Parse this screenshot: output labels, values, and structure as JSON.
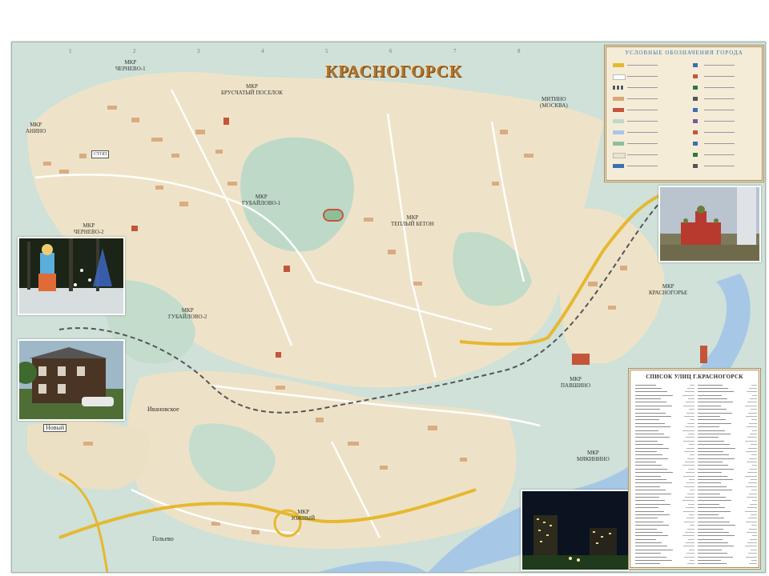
{
  "map": {
    "title": "КРАСНОГОРСК",
    "labels": {
      "cherevo1": "МКР\nЧЕРНЕВО-1",
      "brusyany": "МКР\nБРУСЧАТЫЙ ПОСЕЛОК",
      "anino": "МКР\nАНИНО",
      "cherevo2": "МКР\nЧЕРНЕВО-2",
      "gubailovo1": "МКР\nГУБАЙЛОВО-1",
      "gubailovo2": "МКР\nГУБАЙЛОВО-2",
      "teply_beton": "МКР\nТЕПЛЫЙ БЕТОН",
      "mitino": "МИТИНО\n(МОСКВА)",
      "krasnogorye": "МКР\nКРАСНОГОРЬЕ",
      "pavshino": "МКР\nПАВШИНО",
      "opaliha": "МКР\nМЯКИНИНО",
      "yuzhny": "МКР\nЮЖНЫЙ",
      "ivanovskoe": "Ивановское",
      "novy": "Новый",
      "golyevo": "Гольево",
      "stop": "СТОП"
    }
  },
  "legend": {
    "title": "Условные обозначения города"
  },
  "street_list": {
    "title": "Список улиц г.Красногорск"
  }
}
